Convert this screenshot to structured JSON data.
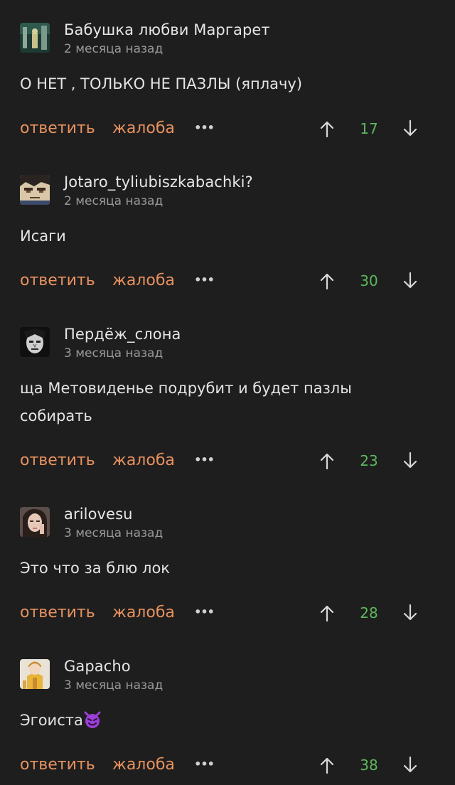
{
  "labels": {
    "reply": "ответить",
    "report": "жалоба",
    "more": "•••"
  },
  "colors": {
    "action": "#e8925f",
    "score": "#5cb85c",
    "background": "#1e1e1e"
  },
  "comments": [
    {
      "author": "Бабушка любви Маргарет",
      "time": "2 месяца назад",
      "text": "О НЕТ , ТОЛЬКО НЕ ПАЗЛЫ (яплачу)",
      "score": "17",
      "avatar": "avatar-dark-green-figure"
    },
    {
      "author": "Jotaro_tyliubiszkabachki?",
      "time": "2 месяца назад",
      "text": "Исаги",
      "score": "30",
      "avatar": "avatar-anime-face"
    },
    {
      "author": "Пердёж_слона",
      "time": "3 месяца назад",
      "text": "ща Метовиденье подрубит и будет пазлы собирать",
      "score": "23",
      "avatar": "avatar-bw-face"
    },
    {
      "author": "arilovesu",
      "time": "3 месяца назад",
      "text": "Это что за блю лок",
      "score": "28",
      "avatar": "avatar-girl-photo"
    },
    {
      "author": "Gapacho",
      "time": "3 месяца назад",
      "text": "Эгоиста",
      "score": "38",
      "avatar": "avatar-yellow-character",
      "emoji": "smiling-imp-emoji"
    }
  ]
}
